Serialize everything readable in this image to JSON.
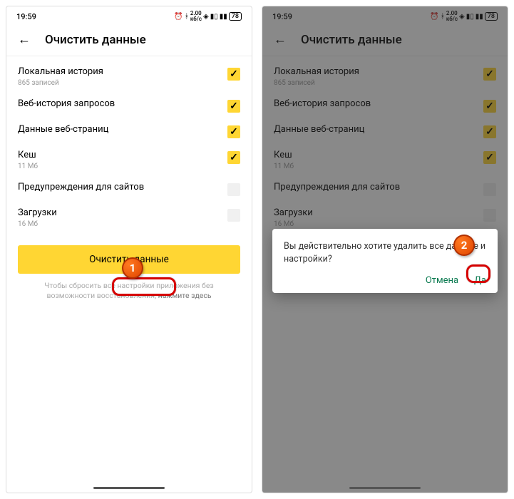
{
  "status": {
    "time": "19:59",
    "battery": "78"
  },
  "header": {
    "title": "Очистить данные"
  },
  "rows": [
    {
      "label": "Локальная история",
      "sub": "865 записей",
      "checked": true
    },
    {
      "label": "Веб-история запросов",
      "sub": "",
      "checked": true
    },
    {
      "label": "Данные веб-страниц",
      "sub": "",
      "checked": true
    },
    {
      "label": "Кеш",
      "sub": "11 Мб",
      "checked": true
    },
    {
      "label": "Предупреждения для сайтов",
      "sub": "",
      "checked": false
    },
    {
      "label": "Загрузки",
      "sub": "16 Мб",
      "checked": false
    }
  ],
  "button": "Очистить данные",
  "footer": {
    "prefix": "Чтобы сбросить все настройки приложения без возможности восстановления, ",
    "link": "нажмите здесь"
  },
  "dialog": {
    "text": "Вы действительно хотите удалить все данные и настройки?",
    "cancel": "Отмена",
    "yes": "Да"
  },
  "callouts": {
    "one": "1",
    "two": "2"
  }
}
